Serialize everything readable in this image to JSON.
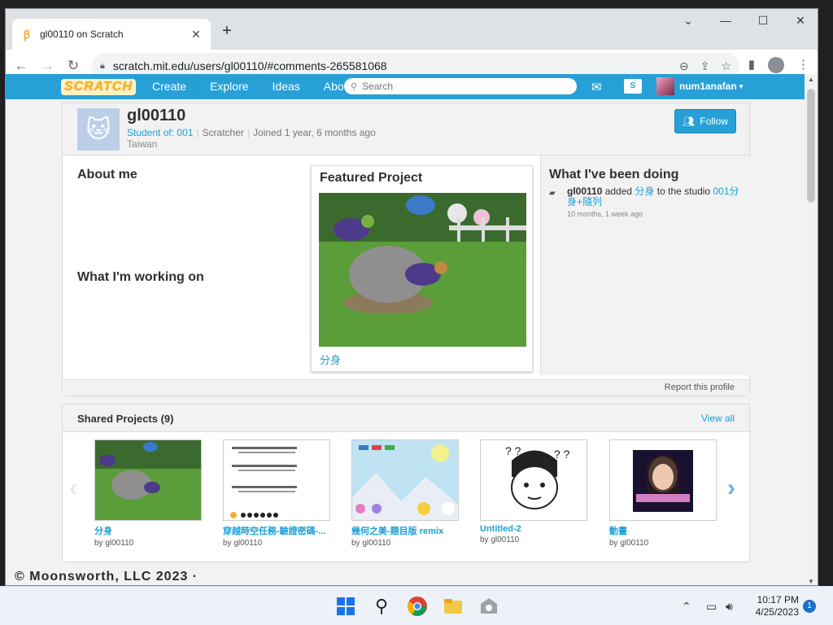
{
  "browser": {
    "tab_title": "gl00110 on Scratch",
    "new_tab": "+",
    "url": "scratch.mit.edu/users/gl00110/#comments-265581068",
    "window_controls": [
      "⌄",
      "—",
      "☐",
      "✕"
    ]
  },
  "scratch_nav": {
    "logo": "SCRATCH",
    "links": [
      "Create",
      "Explore",
      "Ideas",
      "About"
    ],
    "search_placeholder": "Search",
    "username": "num1anafan"
  },
  "profile": {
    "username": "gl00110",
    "student_of_label": "Student of:",
    "student_of_value": "001",
    "role": "Scratcher",
    "joined": "Joined 1 year, 6 months ago",
    "location": "Taiwan",
    "follow_label": "Follow",
    "about_me_heading": "About me",
    "working_on_heading": "What I'm working on",
    "featured_heading": "Featured Project",
    "featured_title": "分身",
    "activity_heading": "What I've been doing",
    "activity": {
      "user": "gl00110",
      "verb": " added ",
      "project": "分身",
      "middle": " to the studio ",
      "studio": "001分身+隨列",
      "time": "10 months, 1 week ago"
    },
    "report_label": "Report this profile"
  },
  "shared_projects": {
    "heading": "Shared Projects (9)",
    "view_all": "View all",
    "items": [
      {
        "title": "分身",
        "by": "by gl00110"
      },
      {
        "title": "穿越時空任務-驗證密碼-...",
        "by": "by gl00110"
      },
      {
        "title": "幾何之美-題目版 remix",
        "by": "by gl00110"
      },
      {
        "title": "Untitled-2",
        "by": "by gl00110"
      },
      {
        "title": "動畫",
        "by": "by gl00110"
      }
    ]
  },
  "taskbar": {
    "watermark": "© Moonsworth, LLC 2023 ·",
    "time": "10:17 PM",
    "date": "4/25/2023",
    "notifications": "1"
  }
}
